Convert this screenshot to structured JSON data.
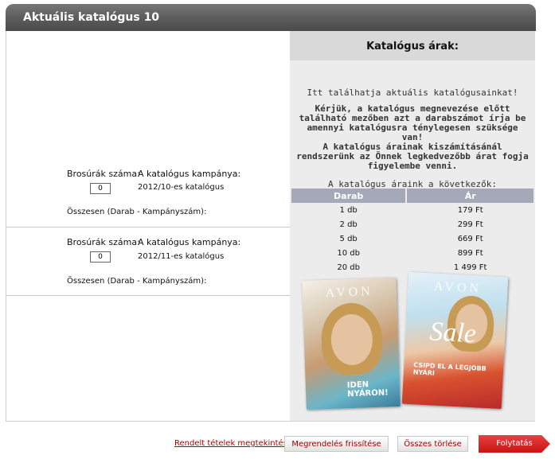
{
  "title": "Aktuális katalógus 10",
  "left": {
    "rows": [
      {
        "brosurak_label": "Brosúrák száma:",
        "campaign_label": "A katalógus kampánya:",
        "quantity": "0",
        "catalog_name": "2012/10-es katalógus",
        "total_label": "Összesen (Darab - Kampányszám):"
      },
      {
        "brosurak_label": "Brosúrák száma:",
        "campaign_label": "A katalógus kampánya:",
        "quantity": "0",
        "catalog_name": "2012/11-es katalógus",
        "total_label": "Összesen (Darab - Kampányszám):"
      }
    ]
  },
  "right": {
    "header": "Katalógus árak:",
    "intro": "Itt találhatja aktuális katalógusainkat!",
    "notice": "Kérjük, a katalógus megnevezése előtt található mezőben azt a darabszámot írja be amennyi katalógusra ténylegesen szüksége van!",
    "notice2": "A katalógus árainak kiszámításánál rendszerünk az Önnek legkedvezőbb árat fogja figyelembe venni.",
    "prices_intro": "A katalógus áraink a következők:",
    "table": {
      "headers": [
        "Darab",
        "Ár"
      ],
      "rows": [
        [
          "1 db",
          "179 Ft"
        ],
        [
          "2 db",
          "299 Ft"
        ],
        [
          "5 db",
          "669 Ft"
        ],
        [
          "10 db",
          "899 Ft"
        ],
        [
          "20 db",
          "1 499 Ft"
        ]
      ]
    },
    "covers": [
      {
        "brand": "AVON",
        "tagline": "IDEN NYÁRON!"
      },
      {
        "brand": "AVON",
        "headline": "Sale",
        "tagline": "CSIPD EL A LEGJOBB NYÁRI"
      }
    ]
  },
  "footer": {
    "link": "Rendelt tételek megtekintése",
    "refresh": "Megrendelés frissítése",
    "clear": "Összes törlése",
    "continue": "Folytatás"
  }
}
